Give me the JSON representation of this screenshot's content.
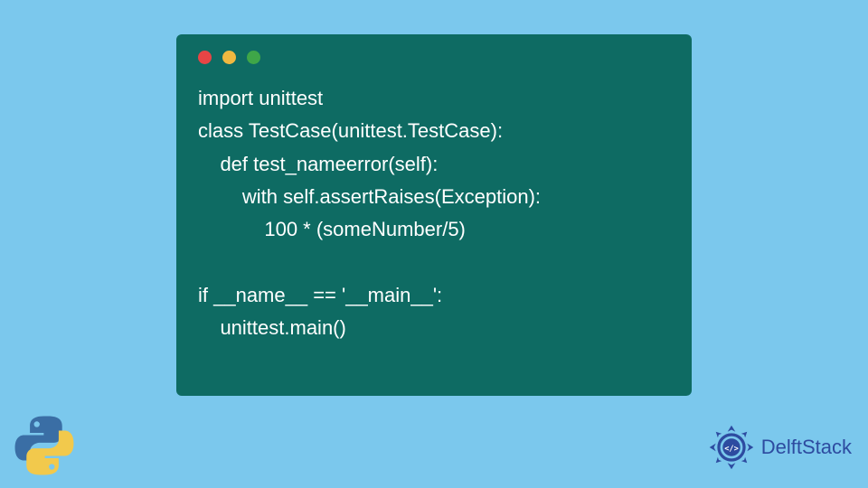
{
  "code": {
    "lines": [
      "import unittest",
      "class TestCase(unittest.TestCase):",
      "    def test_nameerror(self):",
      "        with self.assertRaises(Exception):",
      "            100 * (someNumber/5)",
      "",
      "if __name__ == '__main__':",
      "    unittest.main()"
    ]
  },
  "branding": {
    "name": "DelftStack"
  },
  "colors": {
    "background": "#7bc8ed",
    "window": "#0e6b63",
    "text": "#ffffff",
    "brand": "#2d4ba0"
  }
}
